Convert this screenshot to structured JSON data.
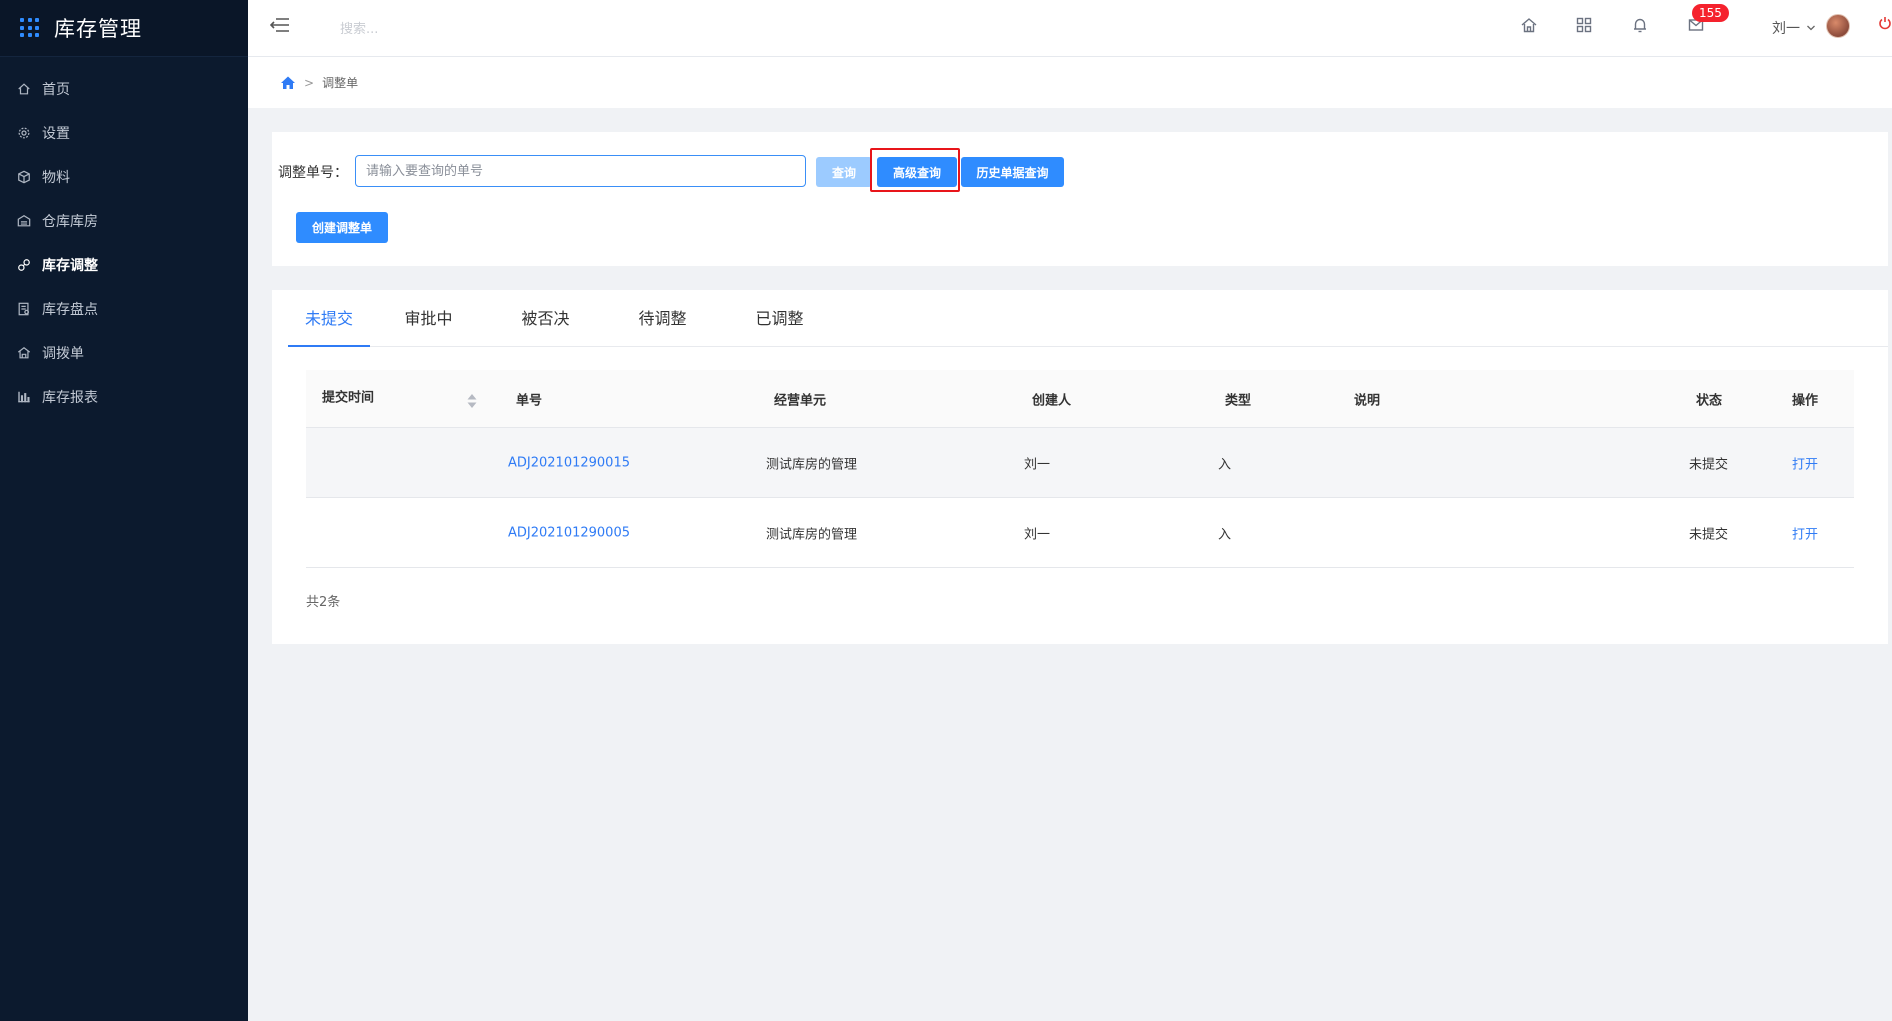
{
  "brand": {
    "title": "库存管理"
  },
  "sidebar": {
    "items": [
      {
        "label": "首页",
        "icon": "home-icon"
      },
      {
        "label": "设置",
        "icon": "gear-icon"
      },
      {
        "label": "物料",
        "icon": "cube-icon"
      },
      {
        "label": "仓库库房",
        "icon": "warehouse-icon"
      },
      {
        "label": "库存调整",
        "icon": "adjust-icon",
        "active": true
      },
      {
        "label": "库存盘点",
        "icon": "inventory-check-icon"
      },
      {
        "label": "调拨单",
        "icon": "transfer-icon"
      },
      {
        "label": "库存报表",
        "icon": "bar-chart-icon"
      }
    ]
  },
  "header": {
    "search_placeholder": "搜索...",
    "notification_count": "155",
    "user_name": "刘一"
  },
  "breadcrumb": {
    "current": "调整单",
    "separator": ">"
  },
  "query": {
    "label": "调整单号：",
    "input_placeholder": "请输入要查询的单号",
    "input_value": "",
    "query_button": "查询",
    "advanced_button": "高级查询",
    "history_button": "历史单据查询",
    "create_button": "创建调整单"
  },
  "tabs": [
    {
      "label": "未提交",
      "active": true
    },
    {
      "label": "审批中"
    },
    {
      "label": "被否决"
    },
    {
      "label": "待调整"
    },
    {
      "label": "已调整"
    }
  ],
  "table": {
    "columns": {
      "submit_time": "提交时间",
      "number": "单号",
      "unit": "经营单元",
      "creator": "创建人",
      "type": "类型",
      "note": "说明",
      "status": "状态",
      "action": "操作"
    },
    "rows": [
      {
        "submit_time": "",
        "number": "ADJ202101290015",
        "unit": "测试库房的管理",
        "creator": "刘一",
        "type": "入",
        "note": "",
        "status": "未提交",
        "action": "打开"
      },
      {
        "submit_time": "",
        "number": "ADJ202101290005",
        "unit": "测试库房的管理",
        "creator": "刘一",
        "type": "入",
        "note": "",
        "status": "未提交",
        "action": "打开"
      }
    ],
    "total": "共2条"
  },
  "colors": {
    "sidebar_bg": "#0c1a2e",
    "accent": "#2f8cff",
    "highlight_outline": "#e8151a",
    "badge": "#f5222d"
  }
}
